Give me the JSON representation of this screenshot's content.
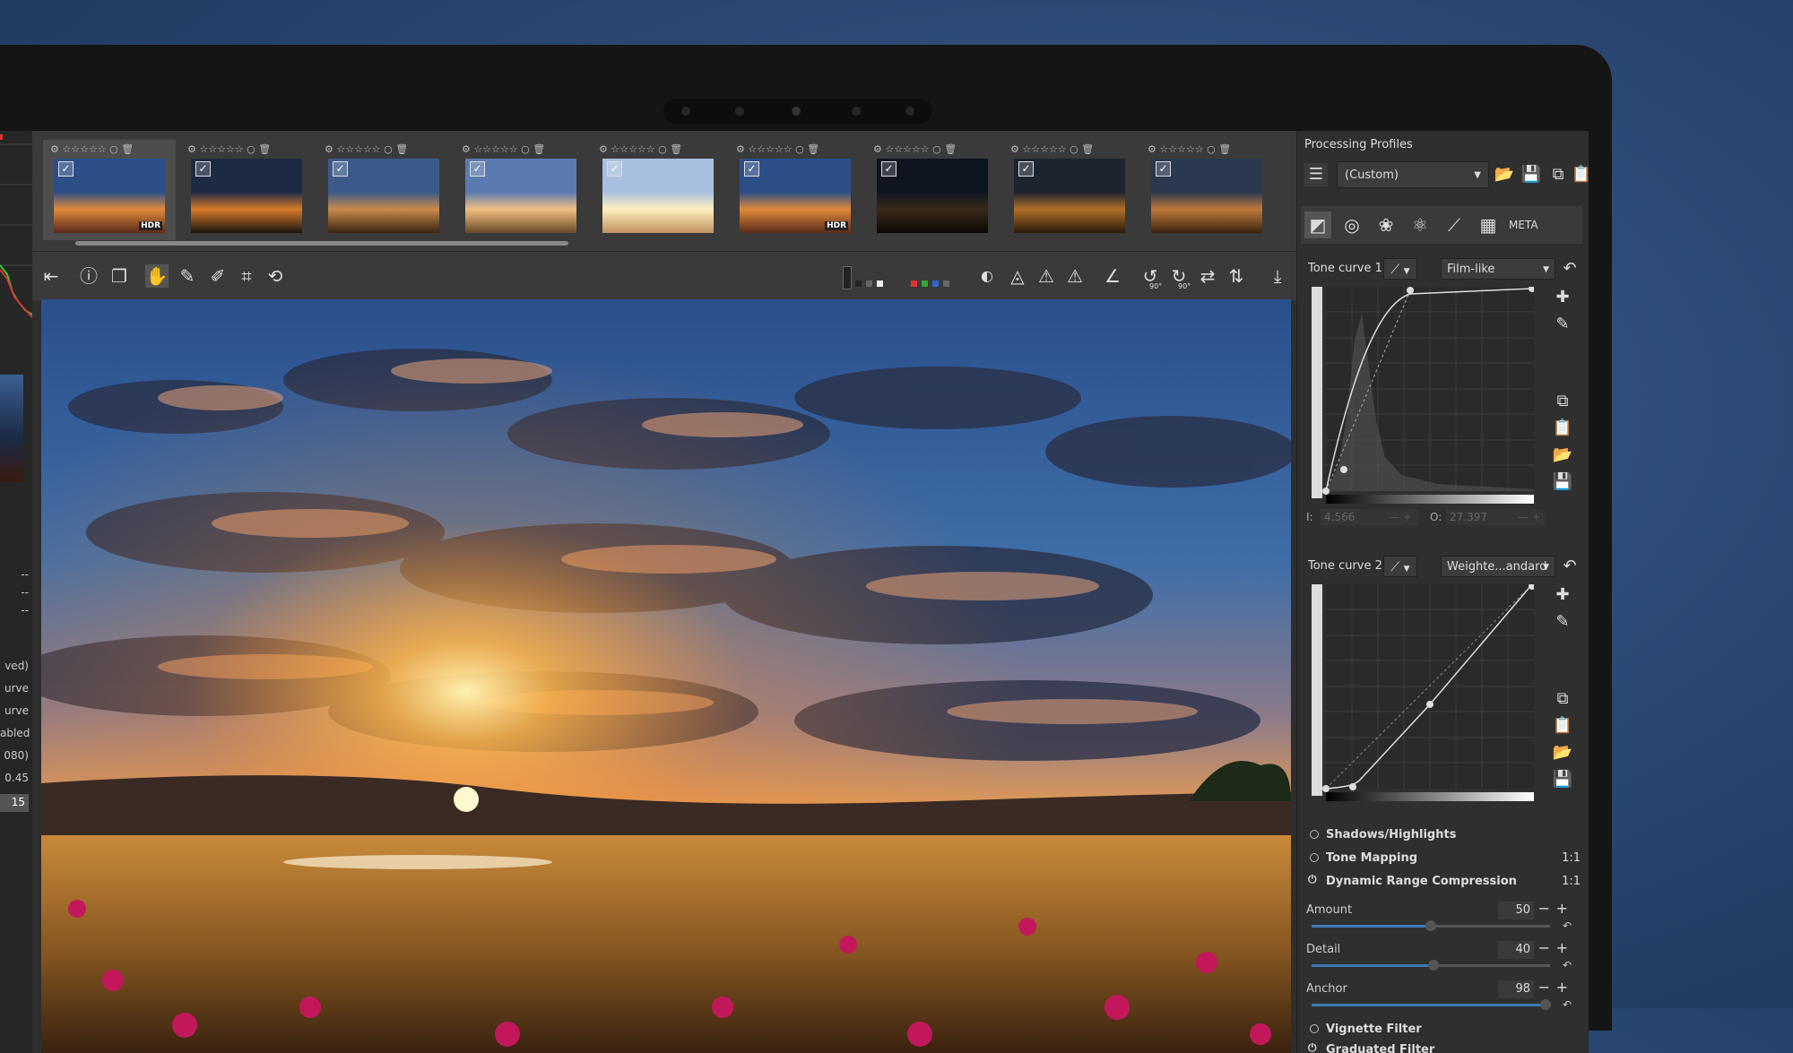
{
  "left_panel": {
    "history_items": [
      "ved)",
      "urve",
      "urve",
      "abled",
      "080)",
      "0.45",
      "15"
    ],
    "dash_items": [
      "--",
      "--",
      "--"
    ]
  },
  "filmstrip": {
    "rating_stars": "☆☆☆☆☆",
    "thumbnails": [
      {
        "hdr": "HDR",
        "selected": true
      },
      {
        "hdr": "",
        "selected": false
      },
      {
        "hdr": "",
        "selected": false
      },
      {
        "hdr": "",
        "selected": false
      },
      {
        "hdr": "",
        "selected": false
      },
      {
        "hdr": "HDR",
        "selected": false
      },
      {
        "hdr": "",
        "selected": false
      },
      {
        "hdr": "",
        "selected": false
      },
      {
        "hdr": "",
        "selected": false
      }
    ]
  },
  "toolbar": {
    "rotate_left_label": "90°",
    "rotate_right_label": "90°"
  },
  "right_panel": {
    "title": "Processing Profiles",
    "profile_value": "(Custom)",
    "meta_tab": "META",
    "tone_curve_1": {
      "label": "Tone curve 1:",
      "mode": "Film-like",
      "input_label": "I:",
      "input_value": "4.566",
      "output_label": "O:",
      "output_value": "27.397"
    },
    "tone_curve_2": {
      "label": "Tone curve 2:",
      "mode": "Weighte...andard"
    },
    "sections": {
      "shadows_highlights": "Shadows/Highlights",
      "tone_mapping": "Tone Mapping",
      "tone_mapping_ratio": "1:1",
      "drc": "Dynamic Range Compression",
      "drc_ratio": "1:1",
      "vignette": "Vignette Filter",
      "graduated": "Graduated Filter"
    },
    "sliders": {
      "amount": {
        "label": "Amount",
        "value": "50",
        "fraction": 0.5
      },
      "detail": {
        "label": "Detail",
        "value": "40",
        "fraction": 0.51
      },
      "anchor": {
        "label": "Anchor",
        "value": "98",
        "fraction": 0.98
      }
    }
  },
  "colors": {
    "accent": "#3d7ab8",
    "panel_bg": "#2f2f2f",
    "background": "#2c4a75"
  }
}
